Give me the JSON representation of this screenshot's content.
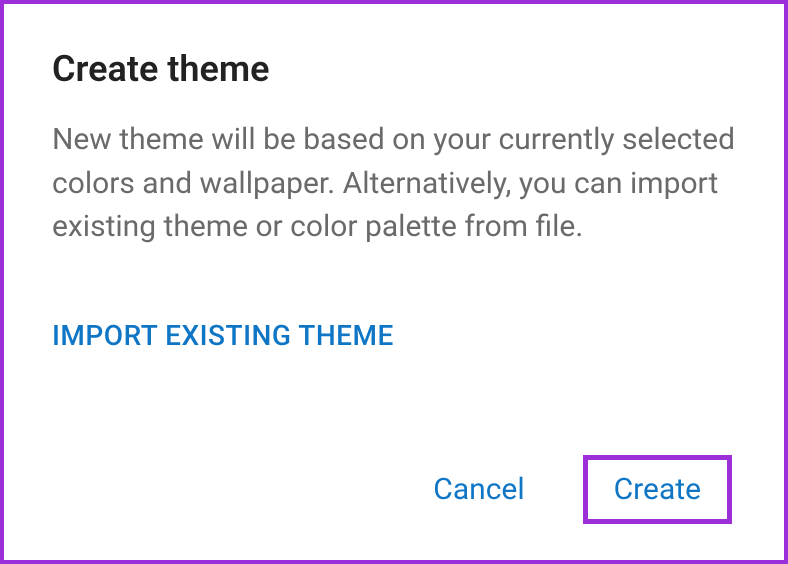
{
  "dialog": {
    "title": "Create theme",
    "description": "New theme will be based on your currently selected colors and wallpaper. Alternatively, you can import existing theme or color palette from file.",
    "import_link": "IMPORT EXISTING THEME",
    "actions": {
      "cancel": "Cancel",
      "create": "Create"
    }
  },
  "colors": {
    "accent_border": "#9b2fd9",
    "link": "#0f76c6",
    "text_primary": "#222222",
    "text_secondary": "#6a6a6a"
  }
}
